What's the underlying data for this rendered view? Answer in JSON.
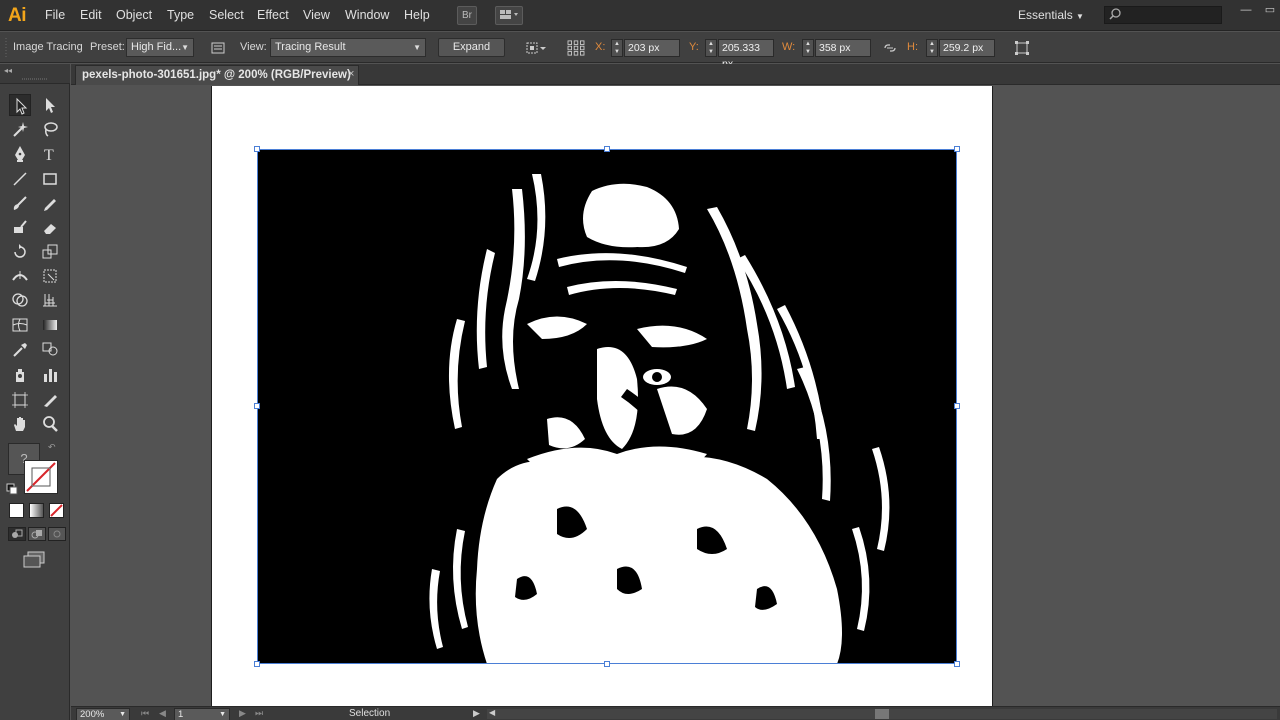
{
  "app": {
    "logo": "Ai"
  },
  "menu": [
    "File",
    "Edit",
    "Object",
    "Type",
    "Select",
    "Effect",
    "View",
    "Window",
    "Help"
  ],
  "menubar": {
    "bridge_label": "Br",
    "workspace": "Essentials",
    "search_placeholder": ""
  },
  "control_bar": {
    "panel_label": "Image Tracing",
    "preset_label": "Preset:",
    "preset_value": "High Fid...",
    "view_label": "View:",
    "view_value": "Tracing Result",
    "expand_label": "Expand",
    "x_label": "X:",
    "x_value": "203 px",
    "y_label": "Y:",
    "y_value": "205.333 px",
    "w_label": "W:",
    "w_value": "358 px",
    "h_label": "H:",
    "h_value": "259.2 px"
  },
  "document": {
    "tab_title": "pexels-photo-301651.jpg* @ 200% (RGB/Preview)",
    "close_glyph": "×"
  },
  "tools": {
    "stroke_fill_question": "?"
  },
  "status_bar": {
    "zoom": "200%",
    "artboard_number": "1",
    "current_tool": "Selection"
  },
  "colors": {
    "accent_logo": "#f2a51a",
    "selection_blue": "#4b7fd6",
    "coord_label_orange": "#e08a3c"
  }
}
